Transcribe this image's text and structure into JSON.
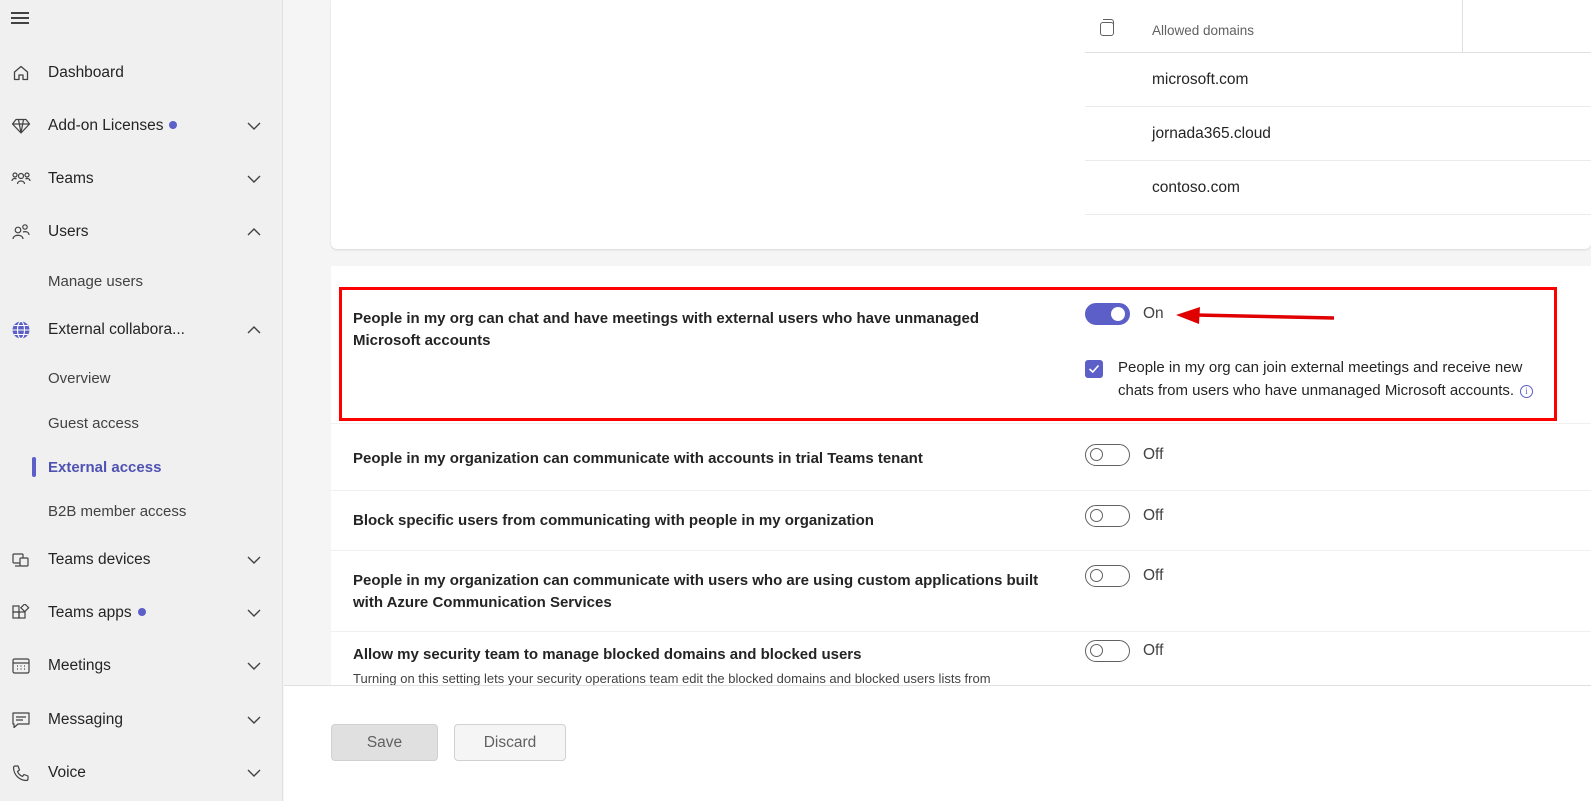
{
  "sidebar": {
    "items": [
      {
        "label": "Dashboard"
      },
      {
        "label": "Add-on Licenses"
      },
      {
        "label": "Teams"
      },
      {
        "label": "Users"
      },
      {
        "label": "Manage users"
      },
      {
        "label": "External collabora..."
      },
      {
        "label": "Overview"
      },
      {
        "label": "Guest access"
      },
      {
        "label": "External access"
      },
      {
        "label": "B2B member access"
      },
      {
        "label": "Teams devices"
      },
      {
        "label": "Teams apps"
      },
      {
        "label": "Meetings"
      },
      {
        "label": "Messaging"
      },
      {
        "label": "Voice"
      }
    ],
    "active_item": "External access",
    "accent_color": "#5b5fc7"
  },
  "domains": {
    "header": "Allowed domains",
    "rows": [
      "microsoft.com",
      "jornada365.cloud",
      "contoso.com"
    ]
  },
  "settings": [
    {
      "title": "People in my org can chat and have meetings with external users who have unmanaged Microsoft accounts",
      "state": "On",
      "checkbox_label": "People in my org can join external meetings and receive new chats from users who have unmanaged Microsoft accounts."
    },
    {
      "title": "People in my organization can communicate with accounts in trial Teams tenant",
      "state": "Off"
    },
    {
      "title": "Block specific users from communicating with people in my organization",
      "state": "Off"
    },
    {
      "title": "People in my organization can communicate with users who are using custom applications built with Azure Communication Services",
      "state": "Off"
    },
    {
      "title": "Allow my security team to manage blocked domains and blocked users",
      "state": "Off",
      "description": "Turning on this setting lets your security operations team edit the blocked domains and blocked users lists from"
    }
  ],
  "footer": {
    "save_label": "Save",
    "discard_label": "Discard"
  },
  "annotation": {
    "highlight_color": "#ff0000"
  }
}
